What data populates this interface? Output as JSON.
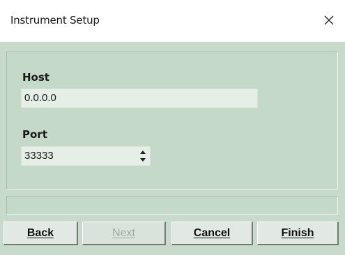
{
  "window": {
    "title": "Instrument Setup",
    "close_icon": "close-icon"
  },
  "form": {
    "host_label": "Host",
    "host_value": "0.0.0.0",
    "port_label": "Port",
    "port_value": "33333"
  },
  "buttons": {
    "back": "Back",
    "next": "Next",
    "cancel": "Cancel",
    "finish": "Finish"
  },
  "colors": {
    "dialog_background": "#c7dacb",
    "button_face": "#e2e8e3",
    "disabled_text": "#a3aaa4"
  }
}
